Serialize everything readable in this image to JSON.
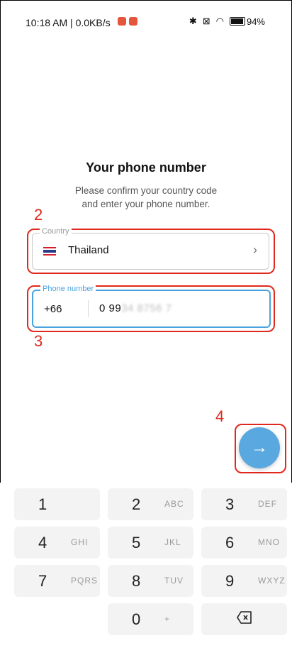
{
  "status_bar": {
    "time": "10:18 AM | 0.0KB/s",
    "battery": "94",
    "battery_level": 0.94
  },
  "header": {
    "title": "Your phone number",
    "subtitle_line1": "Please confirm your country code",
    "subtitle_line2": "and enter your phone number."
  },
  "country": {
    "label": "Country",
    "value": "Thailand",
    "chevron": "›"
  },
  "phone": {
    "label": "Phone number",
    "code": "+66",
    "number_visible": "0 99",
    "number_blurred": "34 8756 7"
  },
  "annotations": [
    "2",
    "3",
    "4"
  ],
  "next_button": {
    "icon": "arrow-right-icon",
    "glyph": "→"
  },
  "keypad": {
    "keys": [
      {
        "digit": "1",
        "letters": ""
      },
      {
        "digit": "2",
        "letters": "ABC"
      },
      {
        "digit": "3",
        "letters": "DEF"
      },
      {
        "digit": "4",
        "letters": "GHI"
      },
      {
        "digit": "5",
        "letters": "JKL"
      },
      {
        "digit": "6",
        "letters": "MNO"
      },
      {
        "digit": "7",
        "letters": "PQRS"
      },
      {
        "digit": "8",
        "letters": "TUV"
      },
      {
        "digit": "9",
        "letters": "WXYZ"
      },
      {
        "digit": "0",
        "letters": "+"
      }
    ]
  },
  "colors": {
    "accent": "#5aa8e0",
    "annotation": "#e0281c",
    "key_bg": "#f3f3f3"
  }
}
